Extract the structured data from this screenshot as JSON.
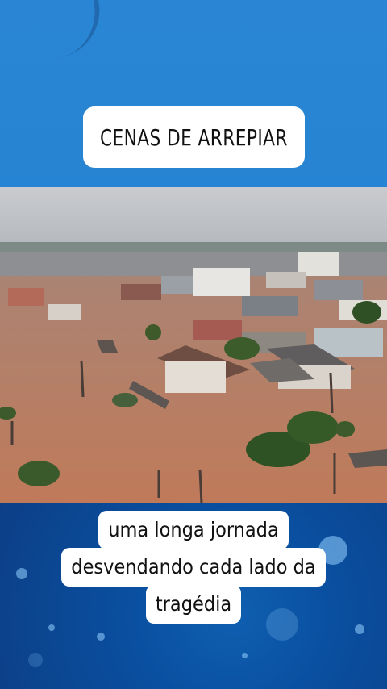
{
  "header": {
    "title": "CENAS DE ARREPIAR"
  },
  "caption": {
    "lines": [
      "uma longa jornada",
      "desvendando cada lado da",
      "tragédia"
    ]
  },
  "colors": {
    "top_background": "#2584d3",
    "bottom_background": "#0c4a98",
    "flood_water": "#b87a5a"
  }
}
